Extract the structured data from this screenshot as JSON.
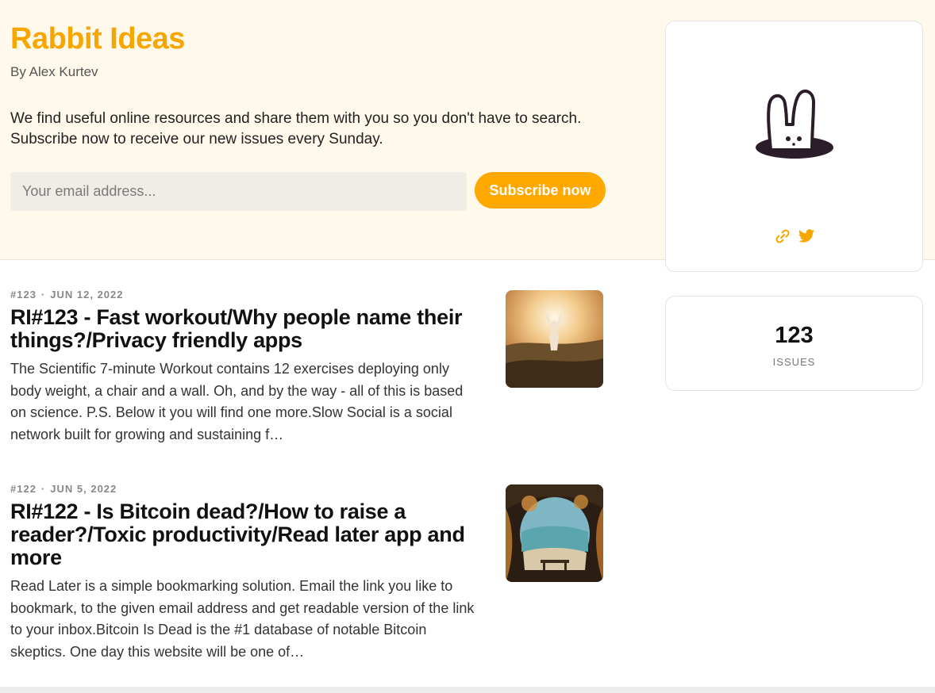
{
  "header": {
    "title": "Rabbit Ideas",
    "byline": "By Alex Kurtev",
    "description": "We find useful online resources and share them with you so you don't have to search. Subscribe now to receive our new issues every Sunday.",
    "email_placeholder": "Your email address...",
    "subscribe_label": "Subscribe now",
    "accent_color": "#ffa800"
  },
  "profile": {
    "logo_icon": "rabbit-in-hat-logo",
    "links": [
      {
        "icon": "link-icon"
      },
      {
        "icon": "twitter-icon"
      }
    ]
  },
  "stats": {
    "issues_count": "123",
    "issues_label": "ISSUES"
  },
  "posts": [
    {
      "number": "#123",
      "date": "JUN 12, 2022",
      "title": "RI#123 - Fast workout/Why people name their things?/Privacy friendly apps",
      "excerpt": "The Scientific 7-minute Workout contains 12 exercises deploying only body weight, a chair and a wall. Oh, and by the way - all of this is based on science. P.S. Below it you will find one more.Slow Social is a social network built for growing and sustaining f…"
    },
    {
      "number": "#122",
      "date": "JUN 5, 2022",
      "title": "RI#122 - Is Bitcoin dead?/How to raise a reader?/Toxic productivity/Read later app and more",
      "excerpt": "Read Later is a simple bookmarking solution. Email the link you like to bookmark, to the given email address and get readable version of the link to your inbox.Bitcoin Is Dead is the #1 database of notable Bitcoin skeptics. One day this website will be one of…"
    }
  ]
}
